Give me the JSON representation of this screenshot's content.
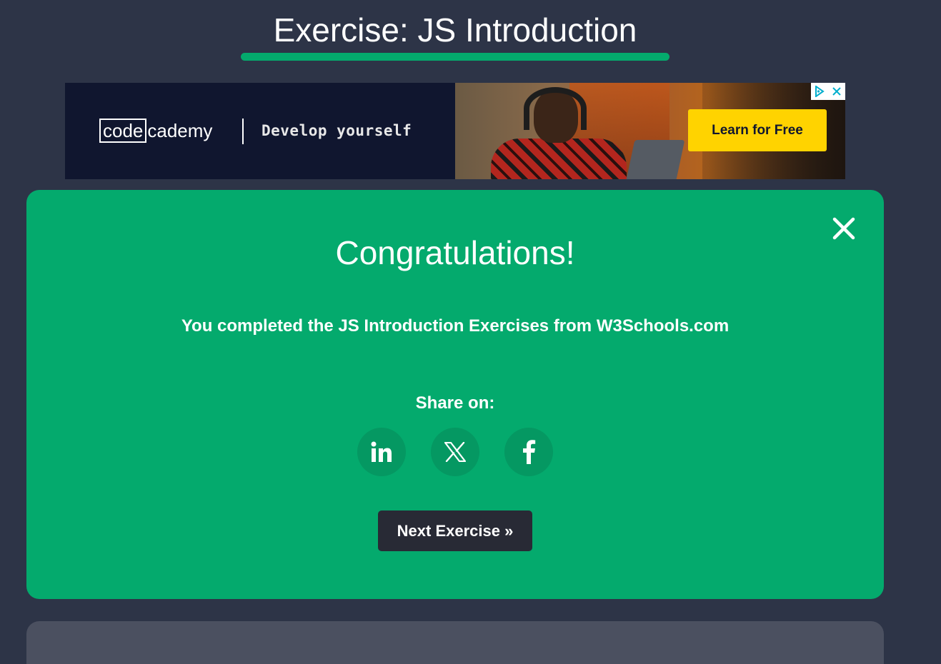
{
  "header": {
    "title": "Exercise: JS Introduction"
  },
  "ad": {
    "logo_box": "code",
    "logo_rest": "cademy",
    "slogan": "Develop yourself",
    "cta": "Learn for Free",
    "choices_icon": "ad-choices-icon",
    "close_icon": "close-icon"
  },
  "modal": {
    "heading": "Congratulations!",
    "message": "You completed the JS Introduction Exercises from W3Schools.com",
    "share_label": "Share on:",
    "share_buttons": [
      {
        "name": "LinkedIn",
        "icon": "linkedin-icon"
      },
      {
        "name": "X",
        "icon": "x-icon"
      },
      {
        "name": "Facebook",
        "icon": "facebook-icon"
      }
    ],
    "next_button": "Next Exercise »"
  },
  "colors": {
    "background": "#2d3447",
    "accent": "#04aa6d",
    "share_button_bg": "#059862",
    "next_button_bg": "#282a35",
    "ad_bg": "#10162f",
    "ad_cta_bg": "#ffd300"
  }
}
